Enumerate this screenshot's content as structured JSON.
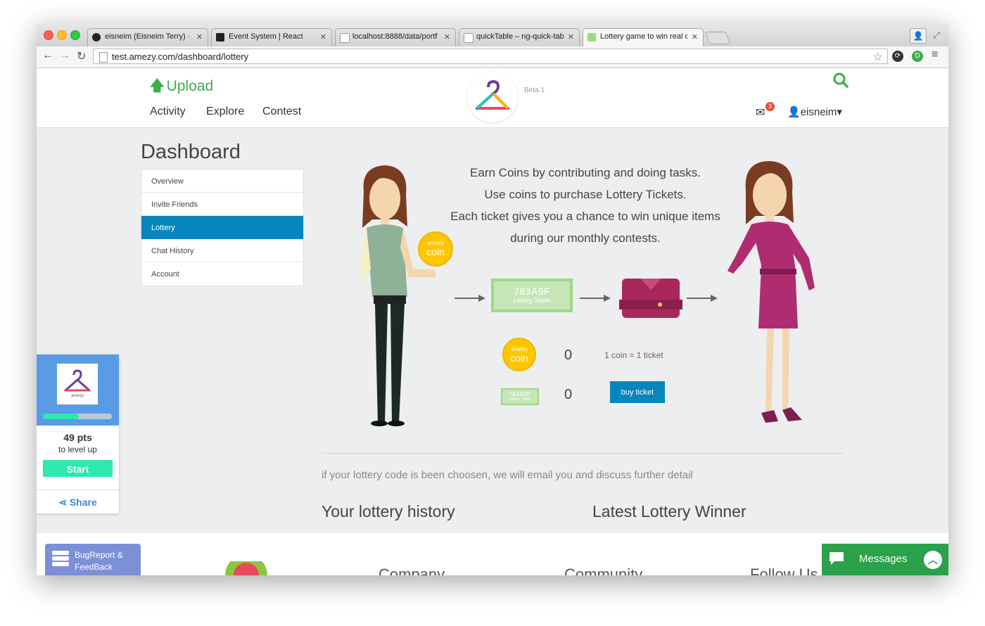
{
  "browser": {
    "tabs": [
      {
        "title": "eisneim (Eisneim Terry) · G"
      },
      {
        "title": "Event System | React"
      },
      {
        "title": "localhost:8888/data/portf"
      },
      {
        "title": "quickTable – ng-quick-tab"
      },
      {
        "title": "Lottery game to win real cl"
      }
    ],
    "url": "test.amezy.com/dashboard/lottery"
  },
  "header": {
    "upload_label": "Upload",
    "beta": "Beta.1",
    "nav": [
      "Activity",
      "Explore",
      "Contest"
    ],
    "mail_count": "3",
    "username": "eisneim▾"
  },
  "dashboard": {
    "title": "Dashboard",
    "menu": [
      "Overview",
      "Invite Friends",
      "Lottery",
      "Chat History",
      "Account"
    ],
    "active_menu": "Lottery"
  },
  "lottery": {
    "intro": [
      "Earn Coins by contributing and doing tasks.",
      "Use coins to purchase Lottery Tickets.",
      "Each ticket gives you a chance to win unique items",
      "during our monthly contests."
    ],
    "ticket_code": "783A9F",
    "ticket_label": "Lottery Ticket",
    "coin_top": "amezy",
    "coin_bottom": "coin",
    "coin_count": "0",
    "ticket_count": "0",
    "rate": "1 coin = 1 ticket",
    "buy_label": "buy ticket",
    "notice": "if your lottery code is been choosen, we will email you and discuss further detail",
    "history_heading": "Your lottery history",
    "winner_heading": "Latest Lottery Winner"
  },
  "footer": {
    "columns": [
      "Company",
      "Community",
      "Follow Us"
    ]
  },
  "level_widget": {
    "logo_text": "amezy",
    "progress": 0.52,
    "points": "49 pts",
    "subtitle": "to level up",
    "start_label": "Start",
    "share_label": "Share"
  },
  "bug_report": {
    "label_line1": "BugReport &",
    "label_line2": "FeedBack"
  },
  "messages": {
    "label": "Messages"
  },
  "colors": {
    "accent_blue": "#0985be",
    "upload_green": "#3cae4b",
    "teal": "#2de8b1",
    "messages_green": "#2ba14b"
  }
}
